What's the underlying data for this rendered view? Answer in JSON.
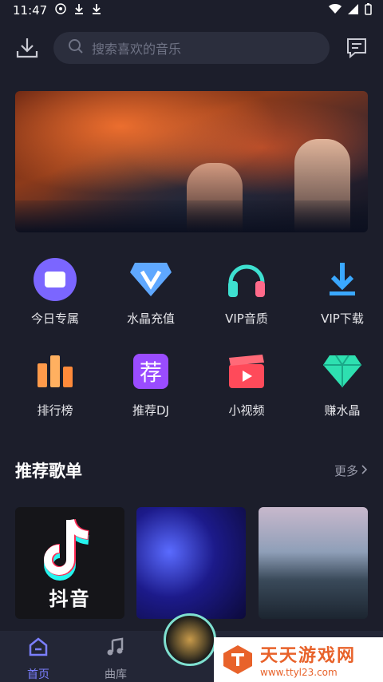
{
  "status": {
    "time": "11:47"
  },
  "search": {
    "placeholder": "搜索喜欢的音乐"
  },
  "grid": [
    {
      "label": "今日专属",
      "icon": "calendar-icon"
    },
    {
      "label": "水晶充值",
      "icon": "crystal-v-icon"
    },
    {
      "label": "VIP音质",
      "icon": "headphones-icon"
    },
    {
      "label": "VIP下载",
      "icon": "download-arrow-icon"
    },
    {
      "label": "排行榜",
      "icon": "bar-chart-icon"
    },
    {
      "label": "推荐DJ",
      "icon": "recommend-icon"
    },
    {
      "label": "小视频",
      "icon": "video-clapper-icon"
    },
    {
      "label": "赚水晶",
      "icon": "diamond-icon"
    }
  ],
  "section": {
    "title": "推荐歌单",
    "more": "更多"
  },
  "cards": [
    {
      "text": "抖音"
    }
  ],
  "tabs": {
    "home": "首页",
    "library": "曲库"
  },
  "watermark": {
    "title": "天天游戏网",
    "url": "www.ttyl23.com"
  },
  "colors": {
    "bg": "#1c1e2b",
    "accent": "#7b7fff",
    "watermark": "#e8622a"
  }
}
